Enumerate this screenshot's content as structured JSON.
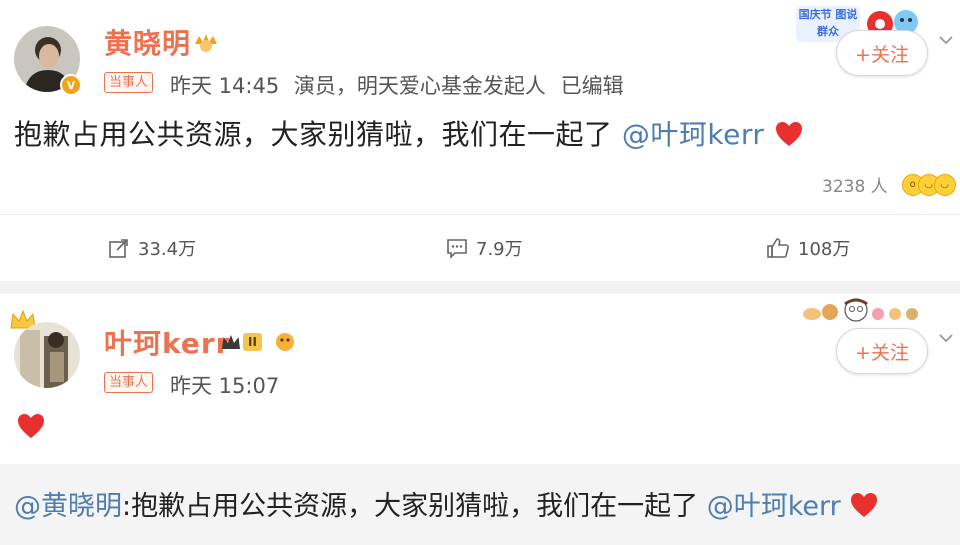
{
  "post1": {
    "author": "黄晓明",
    "party_tag": "当事人",
    "time": "昨天 14:45",
    "bio": "演员，明天爱心基金发起人",
    "edited": "已编辑",
    "follow_label": "+关注",
    "banner_text": "国庆节 图说群众",
    "text": "抱歉占用公共资源，大家别猜啦，我们在一起了",
    "mention": "@叶珂kerr",
    "reaction_count": "3238 人",
    "shares": "33.4万",
    "comments": "7.9万",
    "likes": "108万"
  },
  "post2": {
    "author": "叶珂kerr",
    "level_badge": "II",
    "party_tag": "当事人",
    "time": "昨天 15:07",
    "follow_label": "+关注",
    "quote_mention": "@黄晓明",
    "quote_text": ":抱歉占用公共资源，大家别猜啦，我们在一起了",
    "quote_mention2": "@叶珂kerr"
  },
  "colors": {
    "name": "#eb7350",
    "mention": "#507daf",
    "heart": "#e8302f",
    "verified": "#f0a21b"
  },
  "icons": [
    "share-icon",
    "comment-icon",
    "like-icon",
    "chevron-down-icon",
    "heart-icon",
    "verified-badge-icon",
    "crown-icon"
  ]
}
